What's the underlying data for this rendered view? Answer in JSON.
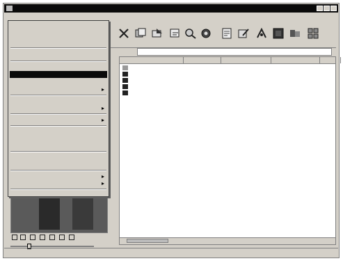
{
  "window": {
    "title": "",
    "buttons": [
      "minimize",
      "maximize",
      "close"
    ]
  },
  "menubar": [
    {
      "label": ""
    },
    {
      "label": ""
    },
    {
      "label": ""
    },
    {
      "label": ""
    },
    {
      "label": ""
    },
    {
      "label": ""
    },
    {
      "label": ""
    }
  ],
  "toolbar": {
    "icons": [
      "delete-icon",
      "copy-icon",
      "move-icon",
      "rename-icon",
      "search-icon",
      "refresh-icon",
      "properties-icon",
      "edit-icon",
      "wallpaper-icon",
      "slideshow-icon",
      "view-icon",
      "thumbnails-icon"
    ]
  },
  "address": {
    "label": "",
    "value": ""
  },
  "list": {
    "columns": [
      {
        "label": ""
      },
      {
        "label": ""
      },
      {
        "label": ""
      },
      {
        "label": ""
      },
      {
        "label": ""
      }
    ],
    "rows": [
      {
        "type": "folder",
        "name": "",
        "size": "",
        "kind": "",
        "date": "",
        "extra": ""
      },
      {
        "type": "file",
        "name": "",
        "size": "",
        "kind": "",
        "date": "",
        "extra": ""
      },
      {
        "type": "file",
        "name": "",
        "size": "",
        "kind": "",
        "date": "",
        "extra": ""
      },
      {
        "type": "file",
        "name": "",
        "size": "",
        "kind": "",
        "date": "",
        "extra": ""
      },
      {
        "type": "file",
        "name": "",
        "size": "",
        "kind": "",
        "date": "",
        "extra": ""
      }
    ]
  },
  "file_menu": {
    "items": [
      {
        "label": "",
        "shortcut": ""
      },
      {
        "label": "",
        "shortcut": ""
      },
      {
        "label": "",
        "shortcut": ""
      },
      {
        "label": "",
        "shortcut": ""
      },
      {
        "label": "",
        "shortcut": ""
      },
      {
        "label": "",
        "shortcut": ""
      },
      {
        "label": "",
        "shortcut": ""
      },
      {
        "label": "",
        "shortcut": ""
      },
      {
        "label": "",
        "shortcut": ""
      },
      {
        "label": "",
        "shortcut": ""
      },
      {
        "label": "",
        "shortcut": ""
      },
      {
        "label": "",
        "shortcut": ""
      },
      {
        "label": "",
        "shortcut": ""
      },
      {
        "label": "",
        "shortcut": ""
      },
      {
        "label": "",
        "shortcut": ""
      },
      {
        "label": "",
        "shortcut": ""
      },
      {
        "label": "",
        "shortcut": ""
      },
      {
        "label": "",
        "shortcut": ""
      },
      {
        "label": "",
        "shortcut": ""
      },
      {
        "label": "",
        "shortcut": ""
      }
    ]
  },
  "slider": {
    "value": ""
  },
  "statusbar": {
    "left": "",
    "center": "",
    "right": ""
  }
}
